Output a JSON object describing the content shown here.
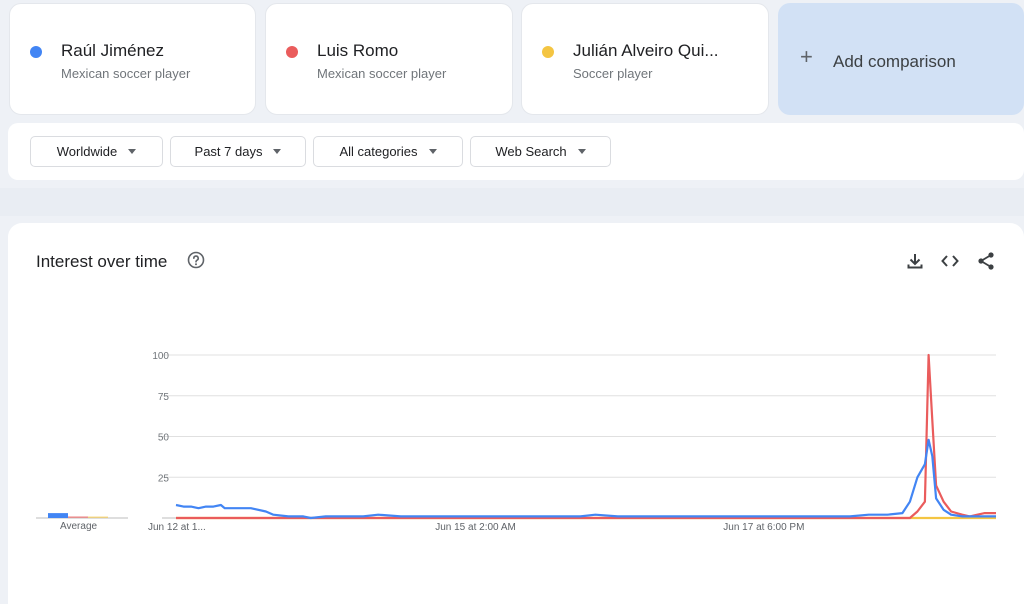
{
  "terms": [
    {
      "name": "Raúl Jiménez",
      "desc": "Mexican soccer player",
      "color": "#4285f4"
    },
    {
      "name": "Luis Romo",
      "desc": "Mexican soccer player",
      "color": "#ea5c5c"
    },
    {
      "name": "Julián Alveiro Qui...",
      "desc": "Soccer player",
      "color": "#f4c542"
    }
  ],
  "add_comparison": {
    "plus": "+",
    "label": "Add comparison"
  },
  "filters": {
    "region": "Worldwide",
    "time": "Past 7 days",
    "category": "All categories",
    "property": "Web Search"
  },
  "chart": {
    "title": "Interest over time",
    "help_icon": "help-circle-icon",
    "download_icon": "download-icon",
    "embed_icon": "embed-code-icon",
    "share_icon": "share-icon",
    "average_label": "Average"
  },
  "chart_data": {
    "type": "line",
    "ylim": [
      0,
      100
    ],
    "yticks": [
      "100",
      "75",
      "50",
      "25"
    ],
    "xticks": [
      {
        "label": "Jun 12 at 1...",
        "index": 0
      },
      {
        "label": "Jun 15 at 2:00 AM",
        "index": 80
      },
      {
        "label": "Jun 17 at 6:00 PM",
        "index": 157
      }
    ],
    "n_points": 220,
    "averages": [
      3,
      1,
      0
    ],
    "series": [
      {
        "name": "Raúl Jiménez",
        "color": "#4285f4",
        "points": [
          [
            0,
            8
          ],
          [
            2,
            7
          ],
          [
            4,
            7
          ],
          [
            6,
            6
          ],
          [
            8,
            7
          ],
          [
            10,
            7
          ],
          [
            12,
            8
          ],
          [
            13,
            6
          ],
          [
            20,
            6
          ],
          [
            24,
            4
          ],
          [
            26,
            2
          ],
          [
            30,
            1
          ],
          [
            34,
            1
          ],
          [
            36,
            0
          ],
          [
            40,
            1
          ],
          [
            50,
            1
          ],
          [
            54,
            2
          ],
          [
            60,
            1
          ],
          [
            70,
            1
          ],
          [
            84,
            1
          ],
          [
            92,
            1
          ],
          [
            100,
            1
          ],
          [
            108,
            1
          ],
          [
            112,
            2
          ],
          [
            118,
            1
          ],
          [
            126,
            1
          ],
          [
            134,
            1
          ],
          [
            140,
            1
          ],
          [
            150,
            1
          ],
          [
            160,
            1
          ],
          [
            170,
            1
          ],
          [
            180,
            1
          ],
          [
            185,
            2
          ],
          [
            190,
            2
          ],
          [
            194,
            3
          ],
          [
            196,
            10
          ],
          [
            198,
            25
          ],
          [
            200,
            33
          ],
          [
            201,
            48
          ],
          [
            202,
            38
          ],
          [
            203,
            12
          ],
          [
            205,
            5
          ],
          [
            207,
            2
          ],
          [
            210,
            1
          ],
          [
            215,
            1
          ],
          [
            219,
            1
          ]
        ]
      },
      {
        "name": "Luis Romo",
        "color": "#ea5c5c",
        "points": [
          [
            0,
            0
          ],
          [
            196,
            0
          ],
          [
            198,
            4
          ],
          [
            200,
            10
          ],
          [
            201,
            100
          ],
          [
            202,
            60
          ],
          [
            203,
            20
          ],
          [
            205,
            10
          ],
          [
            207,
            4
          ],
          [
            210,
            2
          ],
          [
            212,
            1
          ],
          [
            214,
            2
          ],
          [
            216,
            3
          ],
          [
            219,
            3
          ]
        ]
      },
      {
        "name": "Julián Alveiro Quintero",
        "color": "#f4c542",
        "points": [
          [
            0,
            0
          ],
          [
            219,
            0
          ]
        ]
      }
    ]
  }
}
